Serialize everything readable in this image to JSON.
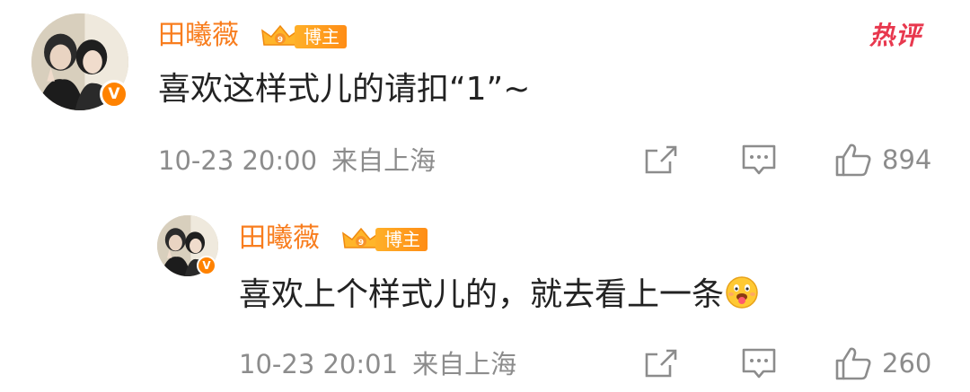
{
  "colors": {
    "username": "#f87d1e",
    "badge_gradient_start": "#ffb028",
    "badge_gradient_end": "#ff8d16",
    "verified": "#ff8200",
    "hot_tag": "#e8384e",
    "meta_text": "#8c8c8c",
    "body_text": "#222222"
  },
  "comment": {
    "avatar_icon": "user-avatar-photo",
    "verified_icon": "verified-v-icon",
    "username": "田曦薇",
    "rank_badge_label": "博主",
    "text": "喜欢这样式儿的请扣“1”~",
    "time": "10-23 20:00",
    "location": "来自上海",
    "hot_tag": "热评",
    "like_count": "894",
    "icons": [
      "share-icon",
      "comment-icon",
      "thumbs-up-icon"
    ]
  },
  "reply": {
    "avatar_icon": "user-avatar-photo",
    "verified_icon": "verified-v-icon",
    "username": "田曦薇",
    "rank_badge_label": "博主",
    "text": "喜欢上个样式儿的，就去看上一条",
    "emoji_icon": "tongue-out-emoji-icon",
    "time": "10-23 20:01",
    "location": "来自上海",
    "like_count": "260",
    "icons": [
      "share-icon",
      "comment-icon",
      "thumbs-up-icon"
    ]
  }
}
